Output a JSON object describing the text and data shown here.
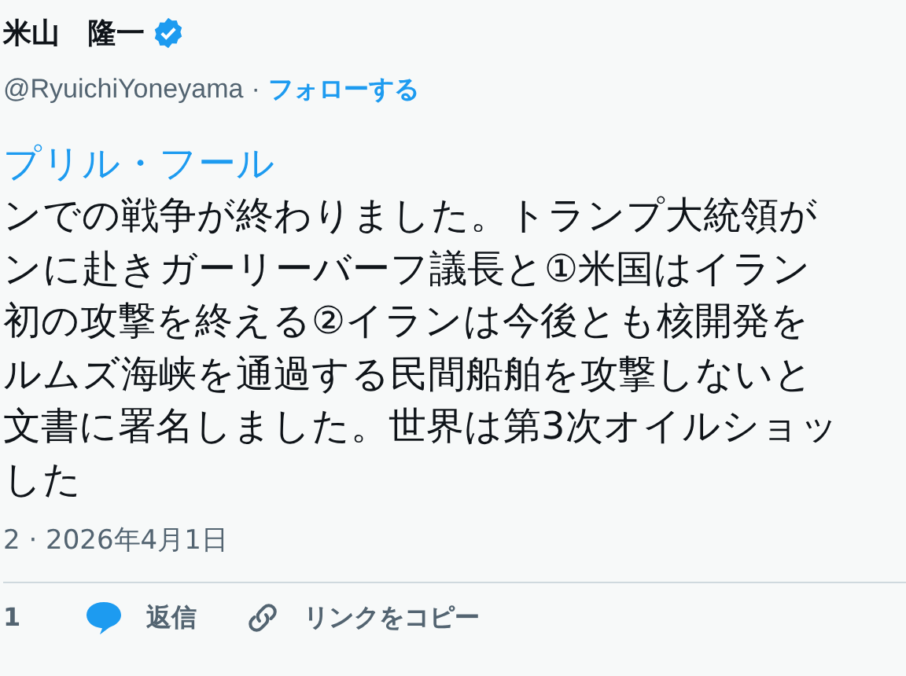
{
  "author": {
    "name": "米山　隆一",
    "verified": true,
    "handle": "@RyuichiYoneyama",
    "separator": "·",
    "follow": "フォローする"
  },
  "tweet": {
    "hashtag": "プリル・フール",
    "lines": [
      "ンでの戦争が終わりました。トランプ大統領が",
      "ンに赴きガーリーバーフ議長と①米国はイラン",
      "初の攻撃を終える②イランは今後とも核開発を",
      "ルムズ海峡を通過する民間船舶を攻撃しないと",
      "文書に署名しました。世界は第3次オイルショッ",
      "した"
    ],
    "meta": "2 · 2026年4月1日"
  },
  "actions": {
    "count": "1",
    "reply": "返信",
    "copy_link": "リンクをコピー"
  }
}
